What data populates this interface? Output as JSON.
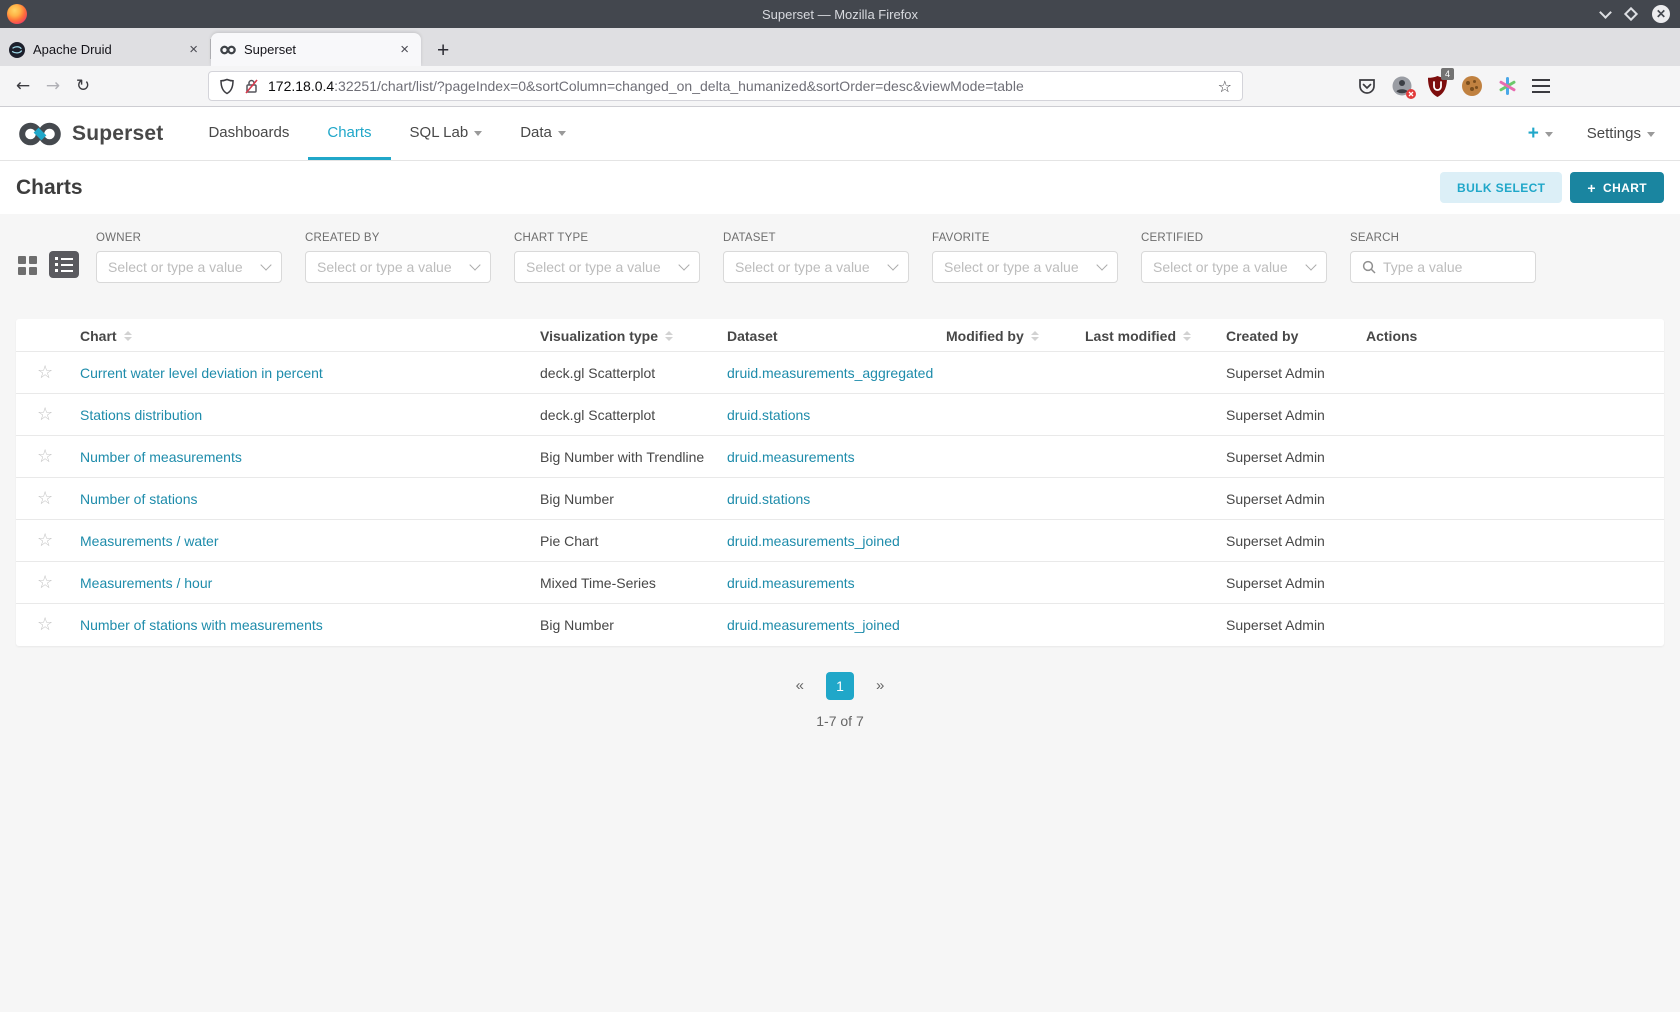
{
  "window": {
    "title": "Superset — Mozilla Firefox"
  },
  "browser": {
    "tabs": [
      {
        "label": "Apache Druid"
      },
      {
        "label": "Superset"
      }
    ],
    "close_tab": "×",
    "new_tab": "+",
    "back": "←",
    "forward": "→",
    "reload": "↻",
    "url": {
      "host": "172.18.0.4",
      "rest": ":32251/chart/list/?pageIndex=0&sortColumn=changed_on_delta_humanized&sortOrder=desc&viewMode=table"
    },
    "bookmark_star": "☆",
    "ublock_badge": "4"
  },
  "nav": {
    "brand": "Superset",
    "items": [
      {
        "label": "Dashboards",
        "active": false,
        "caret": false
      },
      {
        "label": "Charts",
        "active": true,
        "caret": false
      },
      {
        "label": "SQL Lab",
        "active": false,
        "caret": true
      },
      {
        "label": "Data",
        "active": false,
        "caret": true
      }
    ],
    "plus": "+",
    "settings": "Settings"
  },
  "page": {
    "title": "Charts",
    "bulk_select_label": "BULK SELECT",
    "add_chart_plus": "+",
    "add_chart_label": "CHART"
  },
  "filters": {
    "items": [
      {
        "label": "OWNER",
        "placeholder": "Select or type a value",
        "type": "select"
      },
      {
        "label": "CREATED BY",
        "placeholder": "Select or type a value",
        "type": "select"
      },
      {
        "label": "CHART TYPE",
        "placeholder": "Select or type a value",
        "type": "select"
      },
      {
        "label": "DATASET",
        "placeholder": "Select or type a value",
        "type": "select"
      },
      {
        "label": "FAVORITE",
        "placeholder": "Select or type a value",
        "type": "select"
      },
      {
        "label": "CERTIFIED",
        "placeholder": "Select or type a value",
        "type": "select"
      },
      {
        "label": "SEARCH",
        "placeholder": "Type a value",
        "type": "search"
      }
    ]
  },
  "table": {
    "headers": [
      {
        "label": "",
        "sortable": false
      },
      {
        "label": "Chart",
        "sortable": true
      },
      {
        "label": "Visualization type",
        "sortable": true
      },
      {
        "label": "Dataset",
        "sortable": false
      },
      {
        "label": "Modified by",
        "sortable": true
      },
      {
        "label": "Last modified",
        "sortable": true
      },
      {
        "label": "Created by",
        "sortable": false
      },
      {
        "label": "Actions",
        "sortable": false
      }
    ],
    "favorite_star": "☆",
    "rows": [
      {
        "chart": "Current water level deviation in percent",
        "viz_type": "deck.gl Scatterplot",
        "dataset": "druid.measurements_aggregated",
        "modified_by": "",
        "last_modified": "",
        "created_by": "Superset Admin"
      },
      {
        "chart": "Stations distribution",
        "viz_type": "deck.gl Scatterplot",
        "dataset": "druid.stations",
        "modified_by": "",
        "last_modified": "",
        "created_by": "Superset Admin"
      },
      {
        "chart": "Number of measurements",
        "viz_type": "Big Number with Trendline",
        "dataset": "druid.measurements",
        "modified_by": "",
        "last_modified": "",
        "created_by": "Superset Admin"
      },
      {
        "chart": "Number of stations",
        "viz_type": "Big Number",
        "dataset": "druid.stations",
        "modified_by": "",
        "last_modified": "",
        "created_by": "Superset Admin"
      },
      {
        "chart": "Measurements / water",
        "viz_type": "Pie Chart",
        "dataset": "druid.measurements_joined",
        "modified_by": "",
        "last_modified": "",
        "created_by": "Superset Admin"
      },
      {
        "chart": "Measurements / hour",
        "viz_type": "Mixed Time-Series",
        "dataset": "druid.measurements",
        "modified_by": "",
        "last_modified": "",
        "created_by": "Superset Admin"
      },
      {
        "chart": "Number of stations with measurements",
        "viz_type": "Big Number",
        "dataset": "druid.measurements_joined",
        "modified_by": "",
        "last_modified": "",
        "created_by": "Superset Admin"
      }
    ]
  },
  "pagination": {
    "prev": "«",
    "current_page": "1",
    "next": "»",
    "summary": "1-7 of 7"
  },
  "colors": {
    "accent": "#20A7C9",
    "button_primary": "#1A85A0",
    "link": "#1E8CAB",
    "ublock_red": "#7D0D0D",
    "titlebar": "#43474E"
  }
}
